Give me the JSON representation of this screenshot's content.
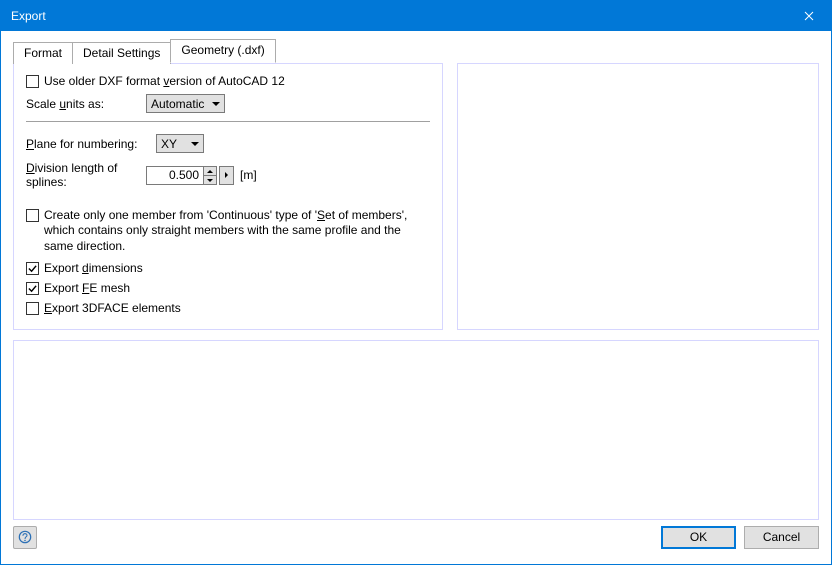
{
  "window": {
    "title": "Export"
  },
  "tabs": {
    "format": "Format",
    "detail": "Detail Settings",
    "geometry": "Geometry (.dxf)"
  },
  "left": {
    "older_dxf_pre": "Use older DXF format ",
    "older_dxf_u": "v",
    "older_dxf_post": "ersion of AutoCAD 12",
    "scale_pre": "Scale ",
    "scale_u": "u",
    "scale_post": "nits as:",
    "scale_value": "Automatic",
    "plane_u": "P",
    "plane_post": "lane for numbering:",
    "plane_value": "XY",
    "division_u": "D",
    "division_post1": "ivision length of",
    "division_post2": "splines:",
    "division_value": "0.500",
    "division_unit": "[m]",
    "continuous_pre": "Create only one member from 'Continuous' type of '",
    "continuous_u": "S",
    "continuous_post": "et of members', which contains only straight members with the same profile and the same direction.",
    "dim_pre": "Export ",
    "dim_u": "d",
    "dim_post": "imensions",
    "fe_pre": "Export ",
    "fe_u": "F",
    "fe_post": "E mesh",
    "face_u": "E",
    "face_post": "xport 3DFACE elements"
  },
  "footer": {
    "ok": "OK",
    "cancel": "Cancel"
  }
}
